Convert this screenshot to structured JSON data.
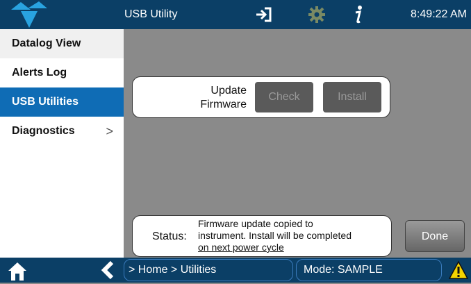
{
  "header": {
    "title": "USB Utility",
    "time": "8:49:22 AM",
    "icons": [
      "teledyne-logo-icon",
      "exit-icon",
      "gear-icon",
      "info-icon"
    ]
  },
  "sidebar": {
    "items": [
      {
        "label": "Datalog View"
      },
      {
        "label": "Alerts Log"
      },
      {
        "label": "USB Utilities",
        "selected": true
      },
      {
        "label": "Diagnostics",
        "chevron": ">"
      }
    ]
  },
  "firmware": {
    "label_line1": "Update",
    "label_line2": "Firmware",
    "check_label": "Check",
    "install_label": "Install"
  },
  "status": {
    "label": "Status:",
    "line1": "Firmware update copied to",
    "line2": "instrument. Install will be completed",
    "line3": "on next power cycle"
  },
  "done_label": "Done",
  "footer": {
    "breadcrumb": "> Home > Utilities",
    "mode": "Mode: SAMPLE",
    "icons": [
      "home-icon",
      "back-icon",
      "warning-icon"
    ]
  },
  "colors": {
    "topbar": "#0b3f66",
    "selected": "#0f6cb5",
    "panel": "#8a8a8a",
    "warning": "#f5d400"
  }
}
